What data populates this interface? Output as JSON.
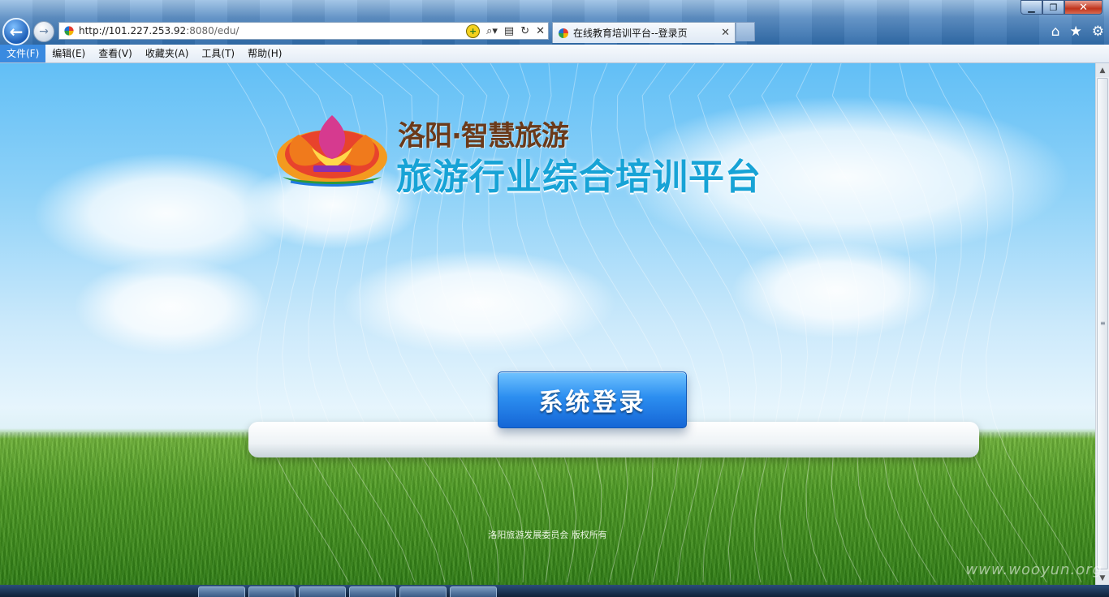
{
  "browser": {
    "url_host": "http://101.227.253.92",
    "url_rest": ":8080/edu/",
    "tab_title": "在线教育培训平台--登录页",
    "icons": [
      "back-arrow",
      "forward-arrow",
      "compat-view",
      "search",
      "refresh",
      "stop",
      "home",
      "favorites-star",
      "settings-gear"
    ]
  },
  "menu": {
    "items": [
      {
        "label": "文件(F)"
      },
      {
        "label": "编辑(E)"
      },
      {
        "label": "查看(V)"
      },
      {
        "label": "收藏夹(A)"
      },
      {
        "label": "工具(T)"
      },
      {
        "label": "帮助(H)"
      }
    ],
    "active_index": 0
  },
  "page": {
    "logo_line1": "洛阳·智慧旅游",
    "logo_line2": "旅游行业综合培训平台",
    "login_button": "系统登录",
    "copyright": "洛阳旅游发展委员会 版权所有"
  },
  "watermark": "www.wooyun.org",
  "colors": {
    "accent": "#1f7ae0",
    "logo_brown": "#6b3a1a",
    "logo_blue": "#17a3d6"
  }
}
